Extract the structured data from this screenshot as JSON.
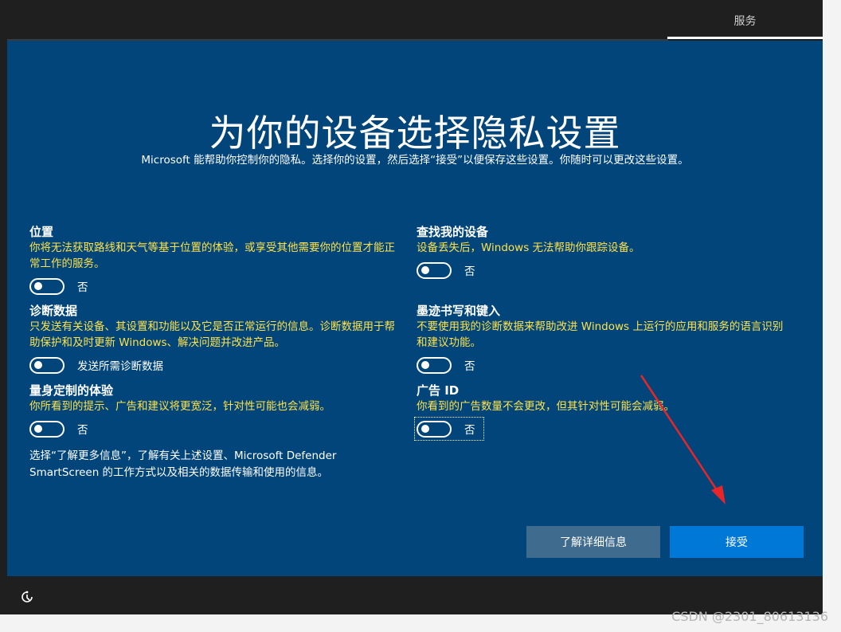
{
  "header": {
    "tab_label": "服务"
  },
  "main": {
    "title": "为你的设备选择隐私设置",
    "subtitle": "Microsoft 能帮助你控制你的隐私。选择你的设置，然后选择“接受”以便保存这些设置。你随时可以更改这些设置。"
  },
  "settings": {
    "location": {
      "title": "位置",
      "desc": "你将无法获取路线和天气等基于位置的体验，或享受其他需要你的位置才能正常工作的服务。",
      "state": "否",
      "on": false
    },
    "find_device": {
      "title": "查找我的设备",
      "desc": "设备丢失后，Windows 无法帮助你跟踪设备。",
      "state": "否",
      "on": false
    },
    "diagnostics": {
      "title": "诊断数据",
      "desc": "只发送有关设备、其设置和功能以及它是否正常运行的信息。诊断数据用于帮助保护和及时更新 Windows、解决问题并改进产品。",
      "state": "发送所需诊断数据",
      "on": false
    },
    "inking": {
      "title": "墨迹书写和键入",
      "desc": "不要使用我的诊断数据来帮助改进 Windows 上运行的应用和服务的语言识别和建议功能。",
      "state": "否",
      "on": false
    },
    "tailored": {
      "title": "量身定制的体验",
      "desc": "你所看到的提示、广告和建议将更宽泛，针对性可能也会减弱。",
      "state": "否",
      "on": false
    },
    "ad_id": {
      "title": "广告 ID",
      "desc": "你看到的广告数量不会更改，但其针对性可能会减弱。",
      "state": "否",
      "on": false
    }
  },
  "footer_note": "选择“了解更多信息”，了解有关上述设置、Microsoft Defender SmartScreen 的工作方式以及相关的数据传输和使用的信息。",
  "buttons": {
    "learn_more": "了解详细信息",
    "accept": "接受"
  },
  "accessibility_icon": "accessibility-icon",
  "watermark": "CSDN @2301_80613136",
  "colors": {
    "background": "#02457a",
    "accent": "#0078d7",
    "desc_text": "#ffe24a"
  }
}
